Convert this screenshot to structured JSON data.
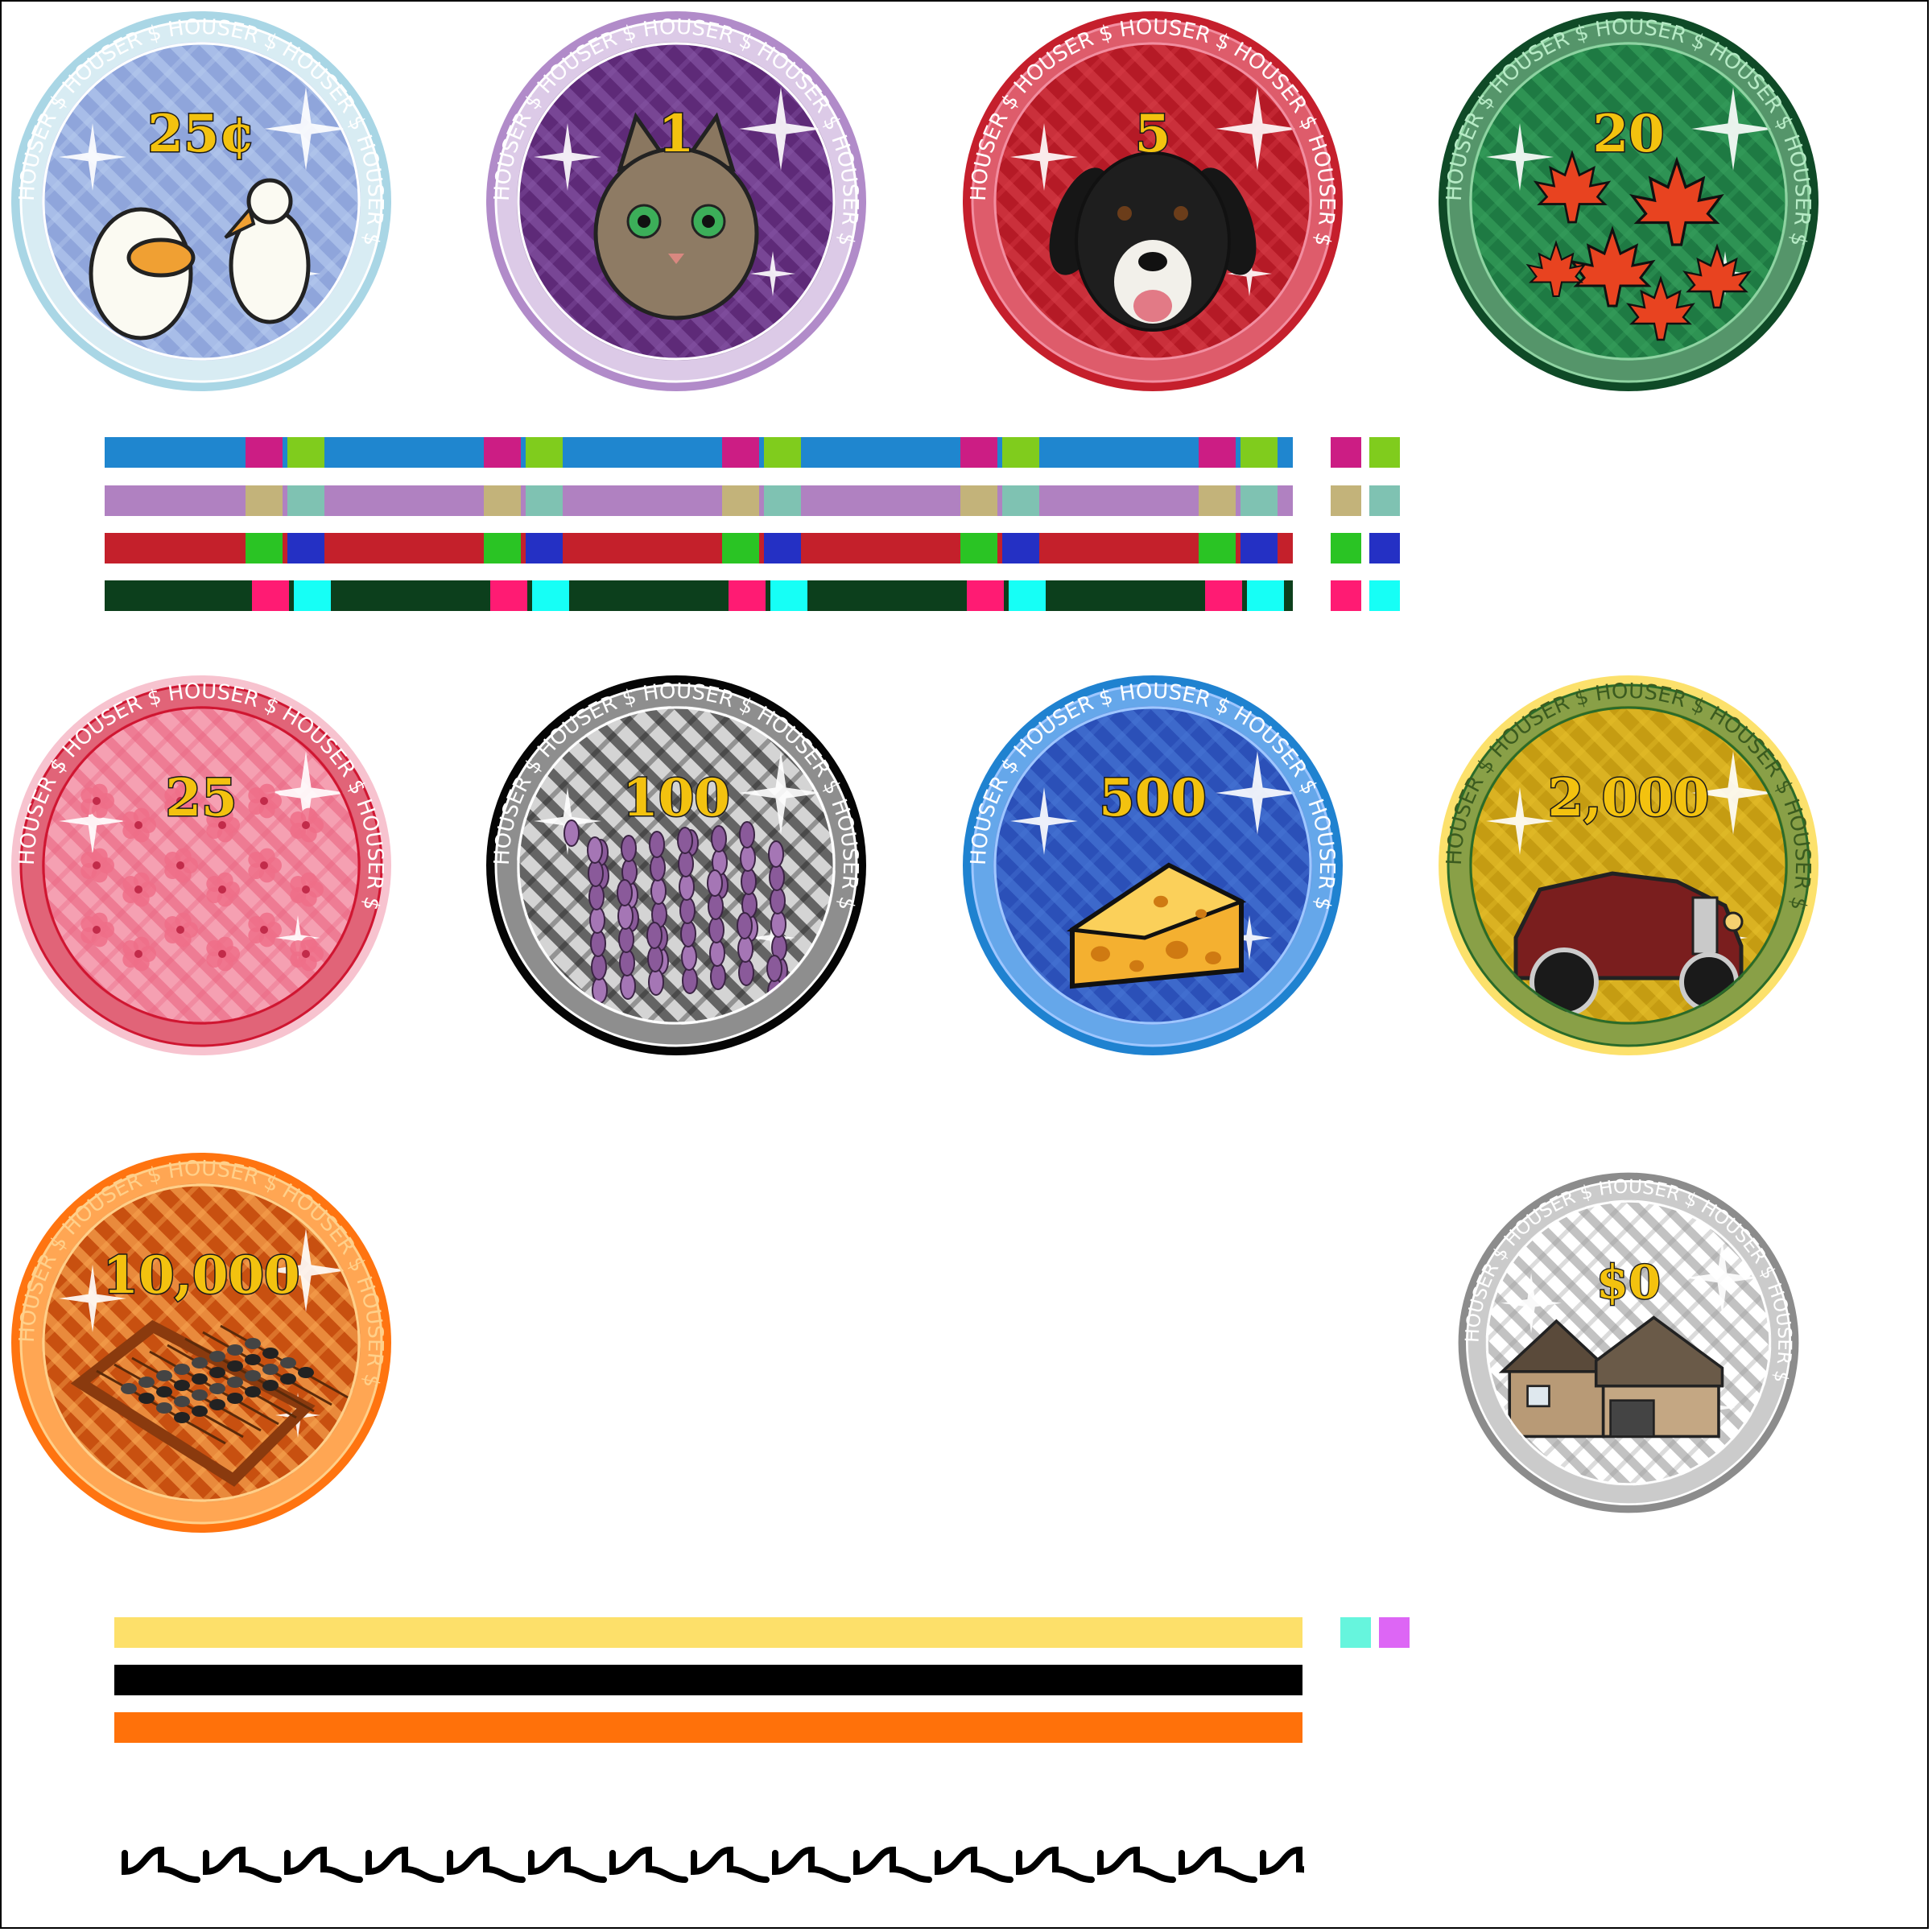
{
  "brand": "HOUSER",
  "chips": [
    {
      "id": "chip-25c",
      "denomination": "25¢",
      "art": "duck-icon",
      "ring": "#a9d6e5",
      "face": "#8fa5db",
      "pattern": "#b9cdf0",
      "band": "#ffffff",
      "text": "#ffffff"
    },
    {
      "id": "chip-1",
      "denomination": "1",
      "art": "cat-icon",
      "ring": "#b18bc9",
      "face": "#5e2a78",
      "pattern": "#8a5aa8",
      "band": "#ffffff",
      "text": "#ffffff"
    },
    {
      "id": "chip-5",
      "denomination": "5",
      "art": "dog-icon",
      "ring": "#c51f2c",
      "face": "#b51a26",
      "pattern": "#d9404a",
      "band": "#f28ea0",
      "text": "#ffffff"
    },
    {
      "id": "chip-20",
      "denomination": "20",
      "art": "maple-leaf-icon",
      "ring": "#0f4a27",
      "face": "#1e7a43",
      "pattern": "#3aa460",
      "band": "#8fd3a2",
      "text": "#b7ebc6"
    },
    {
      "id": "chip-25",
      "denomination": "25",
      "art": "hibiscus-icon",
      "ring": "#f7c3cf",
      "face": "#f5a0b2",
      "pattern": "#ea6480",
      "band": "#cf1631",
      "text": "#ffffff"
    },
    {
      "id": "chip-100",
      "denomination": "100",
      "art": "lavender-icon",
      "ring": "#050505",
      "face": "#d4d4d4",
      "pattern": "#1a1a1a",
      "band": "#ffffff",
      "text": "#ffffff"
    },
    {
      "id": "chip-500",
      "denomination": "500",
      "art": "cheese-icon",
      "ring": "#1f82d0",
      "face": "#2b50b8",
      "pattern": "#4a7ad8",
      "band": "#9fc7ff",
      "text": "#ffffff"
    },
    {
      "id": "chip-2000",
      "denomination": "2,000",
      "art": "vintage-car-icon",
      "ring": "#fce16c",
      "face": "#c59c12",
      "pattern": "#e8c22e",
      "band": "#2a6b2a",
      "text": "#3b5b1f"
    },
    {
      "id": "chip-10000",
      "denomination": "10,000",
      "art": "abacus-icon",
      "ring": "#ff7410",
      "face": "#c85010",
      "pattern": "#ffb15a",
      "band": "#ffd08a",
      "text": "#ffd08a"
    },
    {
      "id": "chip-0",
      "denomination": "$0",
      "art": "house-icon",
      "ring": "#8c8c8c",
      "face": "#ffffff",
      "pattern": "#9a9a9a",
      "band": "#ffffff",
      "text": "#ffffff"
    }
  ],
  "stripe_sets": [
    {
      "base": "#1f86cf",
      "a": "#cc1d84",
      "b": "#80cc1d"
    },
    {
      "base": "#b081c1",
      "a": "#c3b37a",
      "b": "#7fc2b2"
    },
    {
      "base": "#c4202b",
      "a": "#2ac424",
      "b": "#2430c4"
    },
    {
      "base": "#0c3f1c",
      "a": "#ff1b73",
      "b": "#16fff6"
    }
  ],
  "solid_stripes": [
    "#fde06a",
    "#000000",
    "#ff710a"
  ],
  "solid_swatches": [
    "#66f5dd",
    "#dd66f5"
  ],
  "wave_color": "#000000"
}
